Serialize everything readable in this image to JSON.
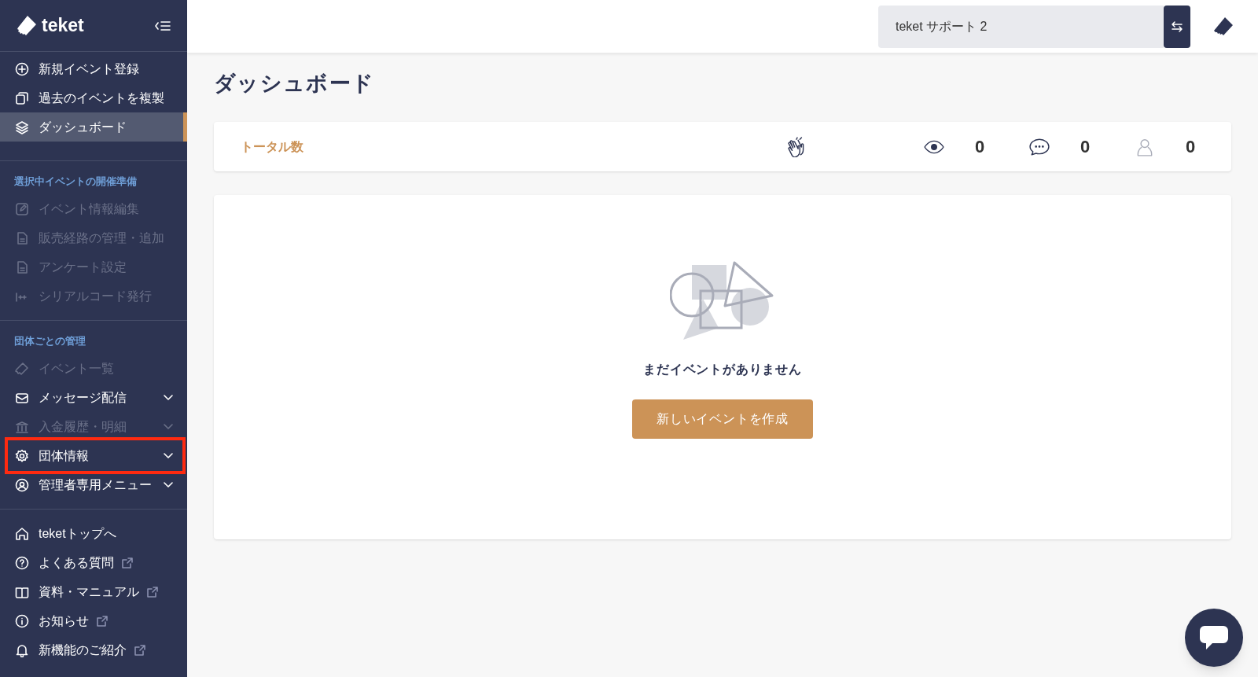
{
  "sidebar": {
    "logo": "teket",
    "groups": [
      {
        "items": [
          {
            "label": "新規イベント登録",
            "disabled": false,
            "selected": false,
            "expandable": false,
            "external": false,
            "highlighted": false
          },
          {
            "label": "過去のイベントを複製",
            "disabled": false,
            "selected": false,
            "expandable": false,
            "external": false,
            "highlighted": false
          },
          {
            "label": "ダッシュボード",
            "disabled": false,
            "selected": true,
            "expandable": false,
            "external": false,
            "highlighted": false
          }
        ]
      },
      {
        "heading": "選択中イベントの開催準備",
        "items": [
          {
            "label": "イベント情報編集",
            "disabled": true,
            "selected": false,
            "expandable": false,
            "external": false,
            "highlighted": false
          },
          {
            "label": "販売経路の管理・追加",
            "disabled": true,
            "selected": false,
            "expandable": false,
            "external": false,
            "highlighted": false
          },
          {
            "label": "アンケート設定",
            "disabled": true,
            "selected": false,
            "expandable": false,
            "external": false,
            "highlighted": false
          },
          {
            "label": "シリアルコード発行",
            "disabled": true,
            "selected": false,
            "expandable": false,
            "external": false,
            "highlighted": false
          }
        ]
      },
      {
        "heading": "団体ごとの管理",
        "items": [
          {
            "label": "イベント一覧",
            "disabled": true,
            "selected": false,
            "expandable": false,
            "external": false,
            "highlighted": false
          },
          {
            "label": "メッセージ配信",
            "disabled": false,
            "selected": false,
            "expandable": true,
            "external": false,
            "highlighted": false
          },
          {
            "label": "入金履歴・明細",
            "disabled": true,
            "selected": false,
            "expandable": true,
            "external": false,
            "highlighted": false
          },
          {
            "label": "団体情報",
            "disabled": false,
            "selected": false,
            "expandable": true,
            "external": false,
            "highlighted": true
          },
          {
            "label": "管理者専用メニュー",
            "disabled": false,
            "selected": false,
            "expandable": true,
            "external": false,
            "highlighted": false
          }
        ]
      },
      {
        "items": [
          {
            "label": "teketトップへ",
            "disabled": false,
            "selected": false,
            "expandable": false,
            "external": false,
            "highlighted": false
          },
          {
            "label": "よくある質問",
            "disabled": false,
            "selected": false,
            "expandable": false,
            "external": true,
            "highlighted": false
          },
          {
            "label": "資料・マニュアル",
            "disabled": false,
            "selected": false,
            "expandable": false,
            "external": true,
            "highlighted": false
          },
          {
            "label": "お知らせ",
            "disabled": false,
            "selected": false,
            "expandable": false,
            "external": true,
            "highlighted": false
          },
          {
            "label": "新機能のご紹介",
            "disabled": false,
            "selected": false,
            "expandable": false,
            "external": true,
            "highlighted": false
          }
        ]
      }
    ]
  },
  "header": {
    "organization_field": {
      "value": "teket サポート 2"
    }
  },
  "page_title": "ダッシュボード",
  "totals": {
    "label": "トータル数",
    "stats": [
      {
        "kind": "claps"
      },
      {
        "kind": "views",
        "value": "0"
      },
      {
        "kind": "comments",
        "value": "0"
      },
      {
        "kind": "attendees",
        "value": "0"
      }
    ]
  },
  "empty_state": {
    "message": "まだイベントがありません",
    "button": "新しいイベントを作成"
  }
}
